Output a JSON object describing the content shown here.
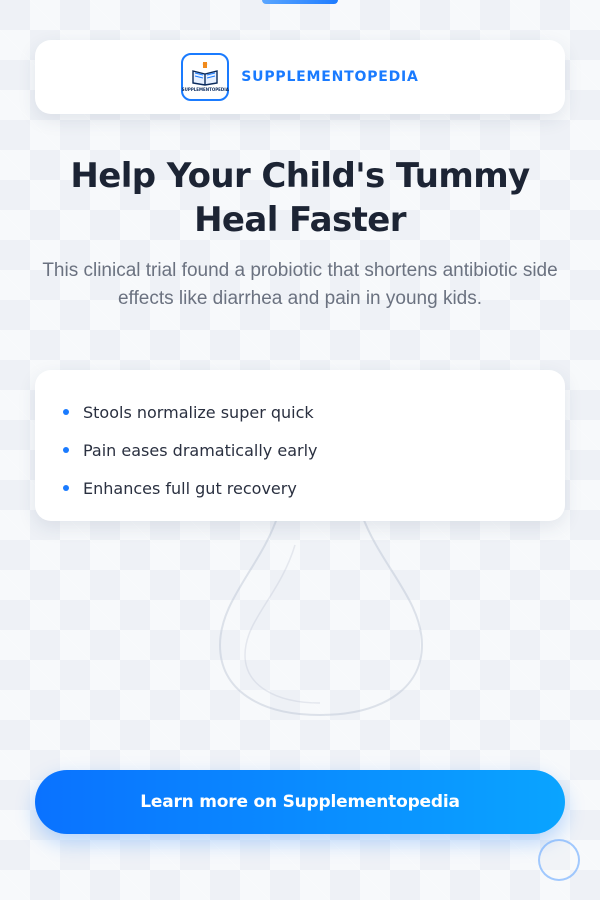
{
  "brand": {
    "name": "SUPPLEMENTOPEDIA",
    "logo_text": "SUPPLEMENTOPEDIA",
    "logo_icon": "open-book-icon",
    "accent_color": "#1a7bff"
  },
  "headline": "Help Your Child's Tummy Heal Faster",
  "subtext": "This clinical trial found a probiotic that shortens antibiotic side effects like diarrhea and pain in young kids.",
  "benefits": [
    "Stools normalize super quick",
    "Pain eases dramatically early",
    "Enhances full gut recovery"
  ],
  "cta": {
    "label": "Learn more on Supplementopedia",
    "gradient": [
      "#0a72ff",
      "#0aa4ff"
    ]
  }
}
